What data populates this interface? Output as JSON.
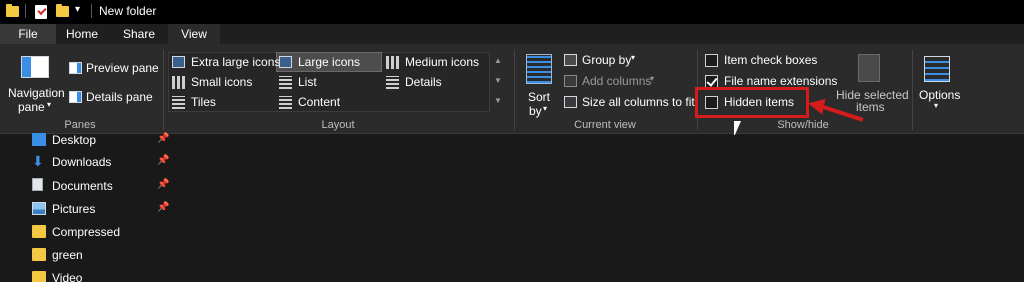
{
  "titlebar": {
    "title": "New folder"
  },
  "tabs": [
    {
      "label": "File"
    },
    {
      "label": "Home"
    },
    {
      "label": "Share"
    },
    {
      "label": "View"
    }
  ],
  "panes": {
    "navigation_pane_line1": "Navigation",
    "navigation_pane_line2": "pane",
    "preview_pane": "Preview pane",
    "details_pane": "Details pane",
    "group_label": "Panes"
  },
  "layout": {
    "items": [
      {
        "label": "Extra large icons"
      },
      {
        "label": "Large icons",
        "selected": true
      },
      {
        "label": "Medium icons"
      },
      {
        "label": "Small icons"
      },
      {
        "label": "List"
      },
      {
        "label": "Details"
      },
      {
        "label": "Tiles"
      },
      {
        "label": "Content"
      }
    ],
    "group_label": "Layout"
  },
  "current_view": {
    "sort_line1": "Sort",
    "sort_line2": "by",
    "group_by": "Group by",
    "add_columns": "Add columns",
    "size_all_columns": "Size all columns to fit",
    "group_label": "Current view"
  },
  "show_hide": {
    "item_check_boxes": {
      "label": "Item check boxes",
      "checked": false
    },
    "file_name_extensions": {
      "label": "File name extensions",
      "checked": true
    },
    "hidden_items": {
      "label": "Hidden items",
      "checked": false
    },
    "hide_selected_line1": "Hide selected",
    "hide_selected_line2": "items",
    "group_label": "Show/hide"
  },
  "options": {
    "label": "Options"
  },
  "nav": {
    "items": [
      {
        "label": "Desktop",
        "icon": "desktop-icon",
        "pinned": true
      },
      {
        "label": "Downloads",
        "icon": "download-icon",
        "pinned": true
      },
      {
        "label": "Documents",
        "icon": "documents-icon",
        "pinned": true
      },
      {
        "label": "Pictures",
        "icon": "pictures-icon",
        "pinned": true
      },
      {
        "label": "Compressed",
        "icon": "folder-icon",
        "pinned": false
      },
      {
        "label": "green",
        "icon": "folder-icon",
        "pinned": false
      },
      {
        "label": "Video",
        "icon": "folder-icon",
        "pinned": false
      }
    ]
  },
  "colors": {
    "highlight": "#d51c1c",
    "accent": "#3a8ee6",
    "folder": "#f4c842"
  }
}
